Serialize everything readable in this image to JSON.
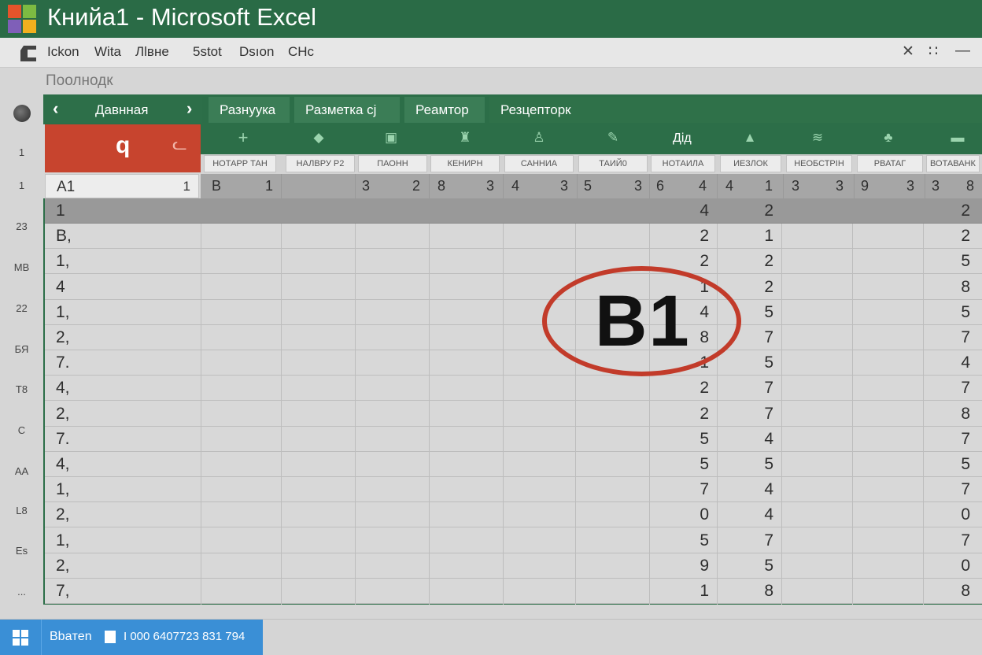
{
  "window": {
    "title": "Книйа1 - Microsoft Excel"
  },
  "menubar": {
    "items": [
      "Ickon",
      "Wita",
      "Лlвне",
      "5stot",
      "Dsıon",
      "CHc"
    ],
    "close_glyph": "✕",
    "more_glyph": "∷",
    "minimize_glyph": "—"
  },
  "subtitle": "Поолнодк",
  "gutter": {
    "labels": [
      "1",
      "1",
      "23",
      "MB",
      "22",
      "БЯ",
      "T8",
      "C",
      "AA",
      "L8",
      "Es",
      "..."
    ]
  },
  "ribbon": {
    "tabs": [
      "Давнная",
      "Разнyукa",
      "Разметка cj",
      "Реaмтор",
      "Резцепторк"
    ],
    "prev_glyph": "‹",
    "next_glyph": "›",
    "icon_label": "Дід"
  },
  "red_block": {
    "letter": "q",
    "glyph": "ᓚ"
  },
  "columns": [
    "НОТАРР ТАН",
    "НАЛВРУ P2",
    "ПАОНН",
    "КЕНИРН",
    "САННИА",
    "ТАИЙ0",
    "НОТАИЛА",
    "ИЕЗЛОК",
    "НЕОБСТРІН",
    "РВАТАГ",
    "ВОТАВАНК"
  ],
  "namebox": {
    "ref": "A1",
    "num": "1"
  },
  "header_row": {
    "pairs": [
      [
        "B",
        "1"
      ],
      [
        "",
        ""
      ],
      [
        "3",
        "2"
      ],
      [
        "8",
        "3"
      ],
      [
        "4",
        "3"
      ],
      [
        "5",
        "3"
      ],
      [
        "6",
        "4"
      ],
      [
        "4",
        "1"
      ],
      [
        "3",
        "3"
      ],
      [
        "9",
        "3"
      ],
      [
        "3",
        "8"
      ]
    ]
  },
  "rows": [
    {
      "a": "1",
      "h": "4",
      "i": "2",
      "m": "2"
    },
    {
      "a": "B,",
      "h": "2",
      "i": "1",
      "m": "2"
    },
    {
      "a": "1,",
      "h": "2",
      "i": "2",
      "m": "5"
    },
    {
      "a": "4",
      "h": "1",
      "i": "2",
      "m": "8"
    },
    {
      "a": "1,",
      "h": "4",
      "i": "5",
      "m": "5"
    },
    {
      "a": "2,",
      "h": "8",
      "i": "7",
      "m": "7"
    },
    {
      "a": "7.",
      "h": "1",
      "i": "5",
      "m": "4"
    },
    {
      "a": "4,",
      "h": "2",
      "i": "7",
      "m": "7"
    },
    {
      "a": "2,",
      "h": "2",
      "i": "7",
      "m": "8"
    },
    {
      "a": "7.",
      "h": "5",
      "i": "4",
      "m": "7"
    },
    {
      "a": "4,",
      "h": "5",
      "i": "5",
      "m": "5"
    },
    {
      "a": "1,",
      "h": "7",
      "i": "4",
      "m": "7"
    },
    {
      "a": "2,",
      "h": "0",
      "i": "4",
      "m": "0"
    },
    {
      "a": "1,",
      "h": "5",
      "i": "7",
      "m": "7"
    },
    {
      "a": "2,",
      "h": "9",
      "i": "5",
      "m": "0"
    },
    {
      "a": "7,",
      "h": "1",
      "i": "8",
      "m": "8"
    }
  ],
  "annotation": {
    "text": "B1",
    "color": "#c23b2a"
  },
  "taskbar": {
    "app_label": "Вbaтen",
    "app_number": "I 000 6407723 831 794"
  },
  "colors": {
    "accent": "#2a6b46",
    "red": "#c7442e",
    "taskbar": "#3a8fd6"
  }
}
